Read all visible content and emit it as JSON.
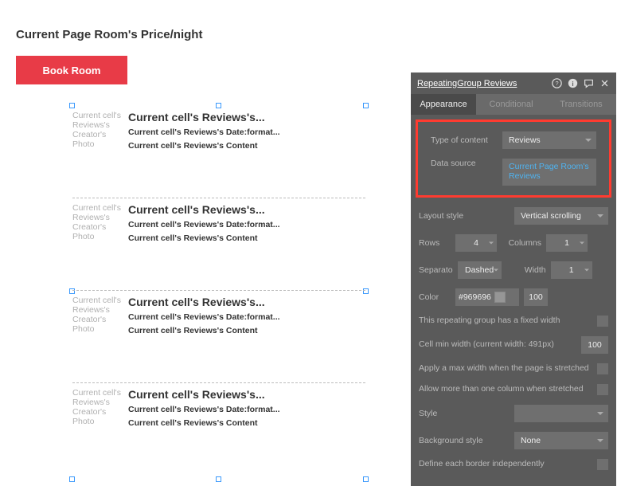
{
  "page": {
    "title": "Current Page Room's Price/night",
    "book_btn": "Book Room"
  },
  "rg_cells": {
    "photo": "Current cell's Reviews's Creator's Photo",
    "title": "Current cell's Reviews's...",
    "date": "Current cell's Reviews's Date:format...",
    "content": "Current cell's Reviews's Content"
  },
  "panel": {
    "title": "RepeatingGroup Reviews",
    "tabs": {
      "appearance": "Appearance",
      "conditional": "Conditional",
      "transitions": "Transitions"
    },
    "type_label": "Type of content",
    "type_value": "Reviews",
    "source_label": "Data source",
    "source_value": "Current Page Room's Reviews",
    "layout_label": "Layout style",
    "layout_value": "Vertical scrolling",
    "rows_label": "Rows",
    "rows_value": "4",
    "cols_label": "Columns",
    "cols_value": "1",
    "sep_label": "Separato",
    "sep_value": "Dashed",
    "width_label": "Width",
    "width_value": "1",
    "color_label": "Color",
    "color_hex": "#969696",
    "color_opacity": "100",
    "fixed_width": "This repeating group has a fixed width",
    "cell_min_width": "Cell min width (current width: 491px)",
    "cell_min_width_value": "100",
    "max_width": "Apply a max width when the page is stretched",
    "more_col": "Allow more than one column when stretched",
    "style_label": "Style",
    "bg_label": "Background style",
    "bg_value": "None",
    "border_label": "Define each border independently"
  }
}
